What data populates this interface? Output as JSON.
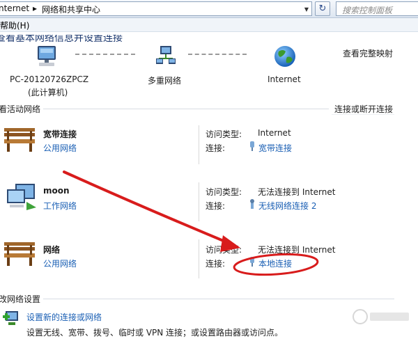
{
  "address": {
    "segments": [
      "nternet",
      "网络和共享中心"
    ],
    "search_placeholder": "搜索控制面板"
  },
  "menu": {
    "help": "帮助(H)"
  },
  "heading": "查看基本网络信息并设置连接",
  "map": {
    "view_full_map": "查看完整映射",
    "nodes": [
      {
        "label": "PC-20120726ZPCZ",
        "sub": "(此计算机)",
        "icon": "computer-icon"
      },
      {
        "label": "多重网络",
        "icon": "network-icon"
      },
      {
        "label": "Internet",
        "icon": "globe-icon"
      }
    ]
  },
  "active": {
    "title": "查看活动网络",
    "connect_link": "连接或断开连接",
    "access_type_label": "访问类型:",
    "connection_label": "连接:",
    "networks": [
      {
        "name": "宽带连接",
        "type": "公用网络",
        "access": "Internet",
        "connection": "宽带连接",
        "icon": "bench-icon"
      },
      {
        "name": "moon",
        "type": "工作网络",
        "access": "无法连接到 Internet",
        "connection": "无线网络连接 2",
        "icon": "computers-icon"
      },
      {
        "name": "网络",
        "type": "公用网络",
        "access": "无法连接到 Internet",
        "connection": "本地连接",
        "icon": "bench-icon"
      }
    ]
  },
  "change": {
    "title": "更改网络设置",
    "setup_link": "设置新的连接或网络",
    "setup_desc": "设置无线、宽带、拨号、临时或 VPN 连接；或设置路由器或访问点。"
  },
  "colors": {
    "link": "#1a5fb4",
    "annotation": "#d81c1c"
  }
}
